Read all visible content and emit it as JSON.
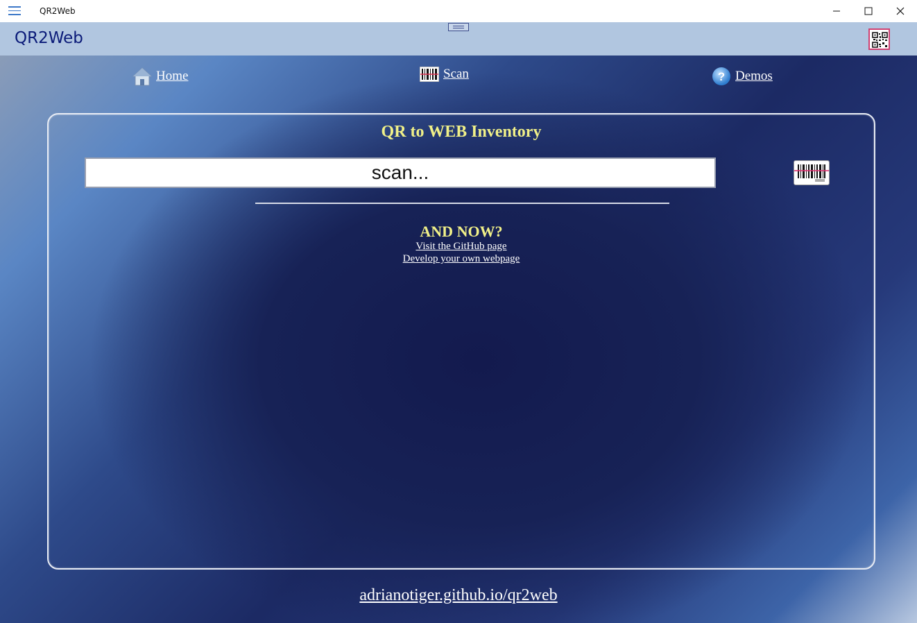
{
  "window": {
    "title": "QR2Web",
    "menu_icon": "hamburger-icon",
    "controls": [
      "minimize-icon",
      "maximize-icon",
      "close-icon"
    ]
  },
  "app_header": {
    "title": "QR2Web",
    "qr_icon": "qr-code-icon",
    "title_color": "#0a1a78",
    "background": "#b1c6e0"
  },
  "nav": {
    "home": {
      "label": "Home",
      "icon": "house-icon"
    },
    "scan": {
      "label": "Scan",
      "icon": "barcode-icon"
    },
    "demos": {
      "label": "Demos",
      "icon": "help-icon"
    }
  },
  "panel": {
    "title": "QR to WEB Inventory",
    "scan_input": {
      "value": "",
      "placeholder": "scan..."
    },
    "barcode_button_icon": "barcode-scanner-icon",
    "and_now": "AND NOW?",
    "links": {
      "github": "Visit the GitHub page",
      "develop": "Develop your own webpage"
    },
    "accent_color": "#f0f088"
  },
  "footer": {
    "link": "adrianotiger.github.io/qr2web"
  }
}
